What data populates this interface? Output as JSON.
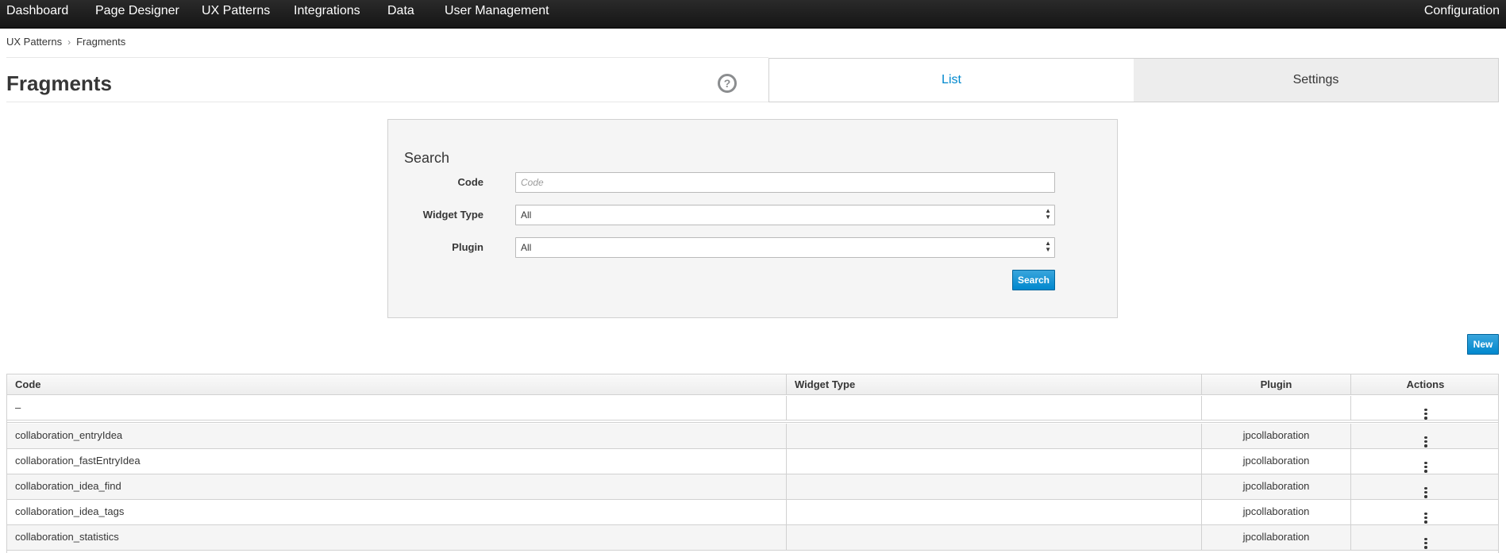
{
  "nav": {
    "items": [
      "Dashboard",
      "Page Designer",
      "UX Patterns",
      "Integrations",
      "Data",
      "User Management"
    ],
    "right": "Configuration"
  },
  "breadcrumb": {
    "parent": "UX Patterns",
    "separator": "›",
    "current": "Fragments"
  },
  "page": {
    "title": "Fragments",
    "help_icon": "question-circle-icon"
  },
  "tabs": {
    "list": "List",
    "settings": "Settings"
  },
  "search": {
    "title": "Search",
    "code_label": "Code",
    "code_placeholder": "Code",
    "code_value": "",
    "widget_type_label": "Widget Type",
    "widget_type_value": "All",
    "plugin_label": "Plugin",
    "plugin_value": "All",
    "search_button": "Search"
  },
  "new_button": "New",
  "table": {
    "headers": [
      "Code",
      "Widget Type",
      "Plugin",
      "Actions"
    ],
    "rows": [
      {
        "code": "–",
        "widget_type": "",
        "plugin": ""
      },
      {
        "code": "collaboration_entryIdea",
        "widget_type": "",
        "plugin": "jpcollaboration"
      },
      {
        "code": "collaboration_fastEntryIdea",
        "widget_type": "",
        "plugin": "jpcollaboration"
      },
      {
        "code": "collaboration_idea_find",
        "widget_type": "",
        "plugin": "jpcollaboration"
      },
      {
        "code": "collaboration_idea_tags",
        "widget_type": "",
        "plugin": "jpcollaboration"
      },
      {
        "code": "collaboration_statistics",
        "widget_type": "",
        "plugin": "jpcollaboration"
      }
    ]
  },
  "colors": {
    "accent": "#0088ce",
    "nav_bg": "#1c1c1c",
    "panel_bg": "#f5f5f5"
  }
}
